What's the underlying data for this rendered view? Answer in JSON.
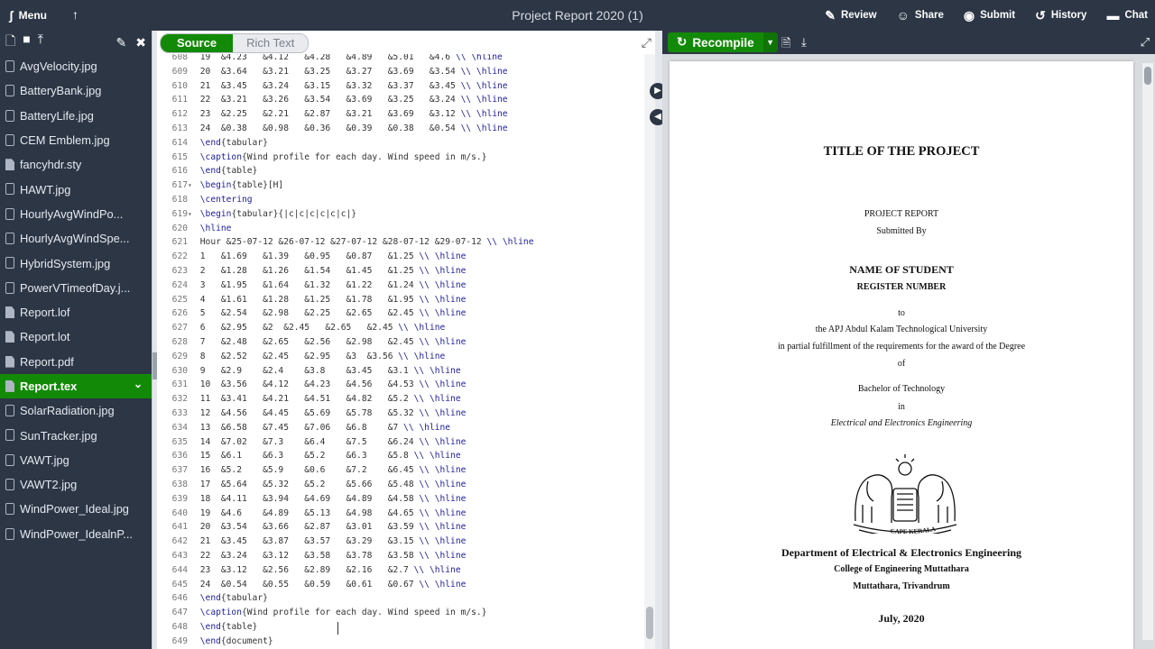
{
  "topbar": {
    "menu_label": "Menu",
    "project_title": "Project Report 2020 (1)",
    "actions": [
      {
        "label": "Review",
        "icon": "review-icon"
      },
      {
        "label": "Share",
        "icon": "share-icon"
      },
      {
        "label": "Submit",
        "icon": "submit-icon"
      },
      {
        "label": "History",
        "icon": "history-icon"
      },
      {
        "label": "Chat",
        "icon": "chat-icon"
      }
    ]
  },
  "sidebar": {
    "files": [
      {
        "name": "AvgVelocity.jpg",
        "kind": "image"
      },
      {
        "name": "BatteryBank.jpg",
        "kind": "image"
      },
      {
        "name": "BatteryLife.jpg",
        "kind": "image"
      },
      {
        "name": "CEM Emblem.jpg",
        "kind": "image"
      },
      {
        "name": "fancyhdr.sty",
        "kind": "doc"
      },
      {
        "name": "HAWT.jpg",
        "kind": "image"
      },
      {
        "name": "HourlyAvgWindPo...",
        "kind": "image"
      },
      {
        "name": "HourlyAvgWindSpe...",
        "kind": "image"
      },
      {
        "name": "HybridSystem.jpg",
        "kind": "image"
      },
      {
        "name": "PowerVTimeofDay.j...",
        "kind": "image"
      },
      {
        "name": "Report.lof",
        "kind": "doc"
      },
      {
        "name": "Report.lot",
        "kind": "doc"
      },
      {
        "name": "Report.pdf",
        "kind": "doc"
      },
      {
        "name": "Report.tex",
        "kind": "doc",
        "selected": true
      },
      {
        "name": "SolarRadiation.jpg",
        "kind": "image"
      },
      {
        "name": "SunTracker.jpg",
        "kind": "image"
      },
      {
        "name": "VAWT.jpg",
        "kind": "image"
      },
      {
        "name": "VAWT2.jpg",
        "kind": "image"
      },
      {
        "name": "WindPower_Ideal.jpg",
        "kind": "image"
      },
      {
        "name": "WindPower_IdealnP...",
        "kind": "image"
      }
    ]
  },
  "editor": {
    "mode_source": "Source",
    "mode_rich": "Rich Text",
    "lines": [
      {
        "n": "608",
        "text": "19  &4.23   &4.12   &4.28   &4.89   &5.01   &4.6 \\\\ \\hline"
      },
      {
        "n": "609",
        "text": "20  &3.64   &3.21   &3.25   &3.27   &3.69   &3.54 \\\\ \\hline"
      },
      {
        "n": "610",
        "text": "21  &3.45   &3.24   &3.15   &3.32   &3.37   &3.45 \\\\ \\hline"
      },
      {
        "n": "611",
        "text": "22  &3.21   &3.26   &3.54   &3.69   &3.25   &3.24 \\\\ \\hline"
      },
      {
        "n": "612",
        "text": "23  &2.25   &2.21   &2.87   &3.21   &3.69   &3.12 \\\\ \\hline"
      },
      {
        "n": "613",
        "text": "24  &0.38   &0.98   &0.36   &0.39   &0.38   &0.54 \\\\ \\hline"
      },
      {
        "n": "614",
        "text": "\\end{tabular}"
      },
      {
        "n": "615",
        "text": "\\caption{Wind profile for each day. Wind speed in m/s.}"
      },
      {
        "n": "616",
        "text": "\\end{table}"
      },
      {
        "n": "617",
        "text": "\\begin{table}[H]",
        "fold": true
      },
      {
        "n": "618",
        "text": "\\centering"
      },
      {
        "n": "619",
        "text": "\\begin{tabular}{|c|c|c|c|c|c|}",
        "fold": true
      },
      {
        "n": "620",
        "text": "\\hline"
      },
      {
        "n": "621",
        "text": "Hour &25-07-12 &26-07-12 &27-07-12 &28-07-12 &29-07-12 \\\\ \\hline"
      },
      {
        "n": "622",
        "text": "1   &1.69   &1.39   &0.95   &0.87   &1.25 \\\\ \\hline"
      },
      {
        "n": "623",
        "text": "2   &1.28   &1.26   &1.54   &1.45   &1.25 \\\\ \\hline"
      },
      {
        "n": "624",
        "text": "3   &1.95   &1.64   &1.32   &1.22   &1.24 \\\\ \\hline"
      },
      {
        "n": "625",
        "text": "4   &1.61   &1.28   &1.25   &1.78   &1.95 \\\\ \\hline"
      },
      {
        "n": "626",
        "text": "5   &2.54   &2.98   &2.25   &2.65   &2.45 \\\\ \\hline"
      },
      {
        "n": "627",
        "text": "6   &2.95   &2  &2.45   &2.65   &2.45 \\\\ \\hline"
      },
      {
        "n": "628",
        "text": "7   &2.48   &2.65   &2.56   &2.98   &2.45 \\\\ \\hline"
      },
      {
        "n": "629",
        "text": "8   &2.52   &2.45   &2.95   &3  &3.56 \\\\ \\hline"
      },
      {
        "n": "630",
        "text": "9   &2.9    &2.4    &3.8    &3.45   &3.1 \\\\ \\hline"
      },
      {
        "n": "631",
        "text": "10  &3.56   &4.12   &4.23   &4.56   &4.53 \\\\ \\hline"
      },
      {
        "n": "632",
        "text": "11  &3.41   &4.21   &4.51   &4.82   &5.2 \\\\ \\hline"
      },
      {
        "n": "633",
        "text": "12  &4.56   &4.45   &5.69   &5.78   &5.32 \\\\ \\hline"
      },
      {
        "n": "634",
        "text": "13  &6.58   &7.45   &7.06   &6.8    &7 \\\\ \\hline"
      },
      {
        "n": "635",
        "text": "14  &7.02   &7.3    &6.4    &7.5    &6.24 \\\\ \\hline"
      },
      {
        "n": "636",
        "text": "15  &6.1    &6.3    &5.2    &6.3    &5.8 \\\\ \\hline"
      },
      {
        "n": "637",
        "text": "16  &5.2    &5.9    &0.6    &7.2    &6.45 \\\\ \\hline"
      },
      {
        "n": "638",
        "text": "17  &5.64   &5.32   &5.2    &5.66   &5.48 \\\\ \\hline"
      },
      {
        "n": "639",
        "text": "18  &4.11   &3.94   &4.69   &4.89   &4.58 \\\\ \\hline"
      },
      {
        "n": "640",
        "text": "19  &4.6    &4.89   &5.13   &4.98   &4.65 \\\\ \\hline"
      },
      {
        "n": "641",
        "text": "20  &3.54   &3.66   &2.87   &3.01   &3.59 \\\\ \\hline"
      },
      {
        "n": "642",
        "text": "21  &3.45   &3.87   &3.57   &3.29   &3.15 \\\\ \\hline"
      },
      {
        "n": "643",
        "text": "22  &3.24   &3.12   &3.58   &3.78   &3.58 \\\\ \\hline"
      },
      {
        "n": "644",
        "text": "23  &3.12   &2.56   &2.89   &2.16   &2.7 \\\\ \\hline"
      },
      {
        "n": "645",
        "text": "24  &0.54   &0.55   &0.59   &0.61   &0.67 \\\\ \\hline"
      },
      {
        "n": "646",
        "text": "\\end{tabular}"
      },
      {
        "n": "647",
        "text": "\\caption{Wind profile for each day. Wind speed in m/s.}"
      },
      {
        "n": "648",
        "text": "\\end{table}"
      },
      {
        "n": "649",
        "text": "\\end{document}"
      }
    ]
  },
  "pdf": {
    "recompile_label": "Recompile",
    "title": "TITLE OF THE PROJECT",
    "project_report": "PROJECT REPORT",
    "submitted_by": "Submitted By",
    "student_name": "NAME OF STUDENT",
    "register_number": "REGISTER NUMBER",
    "to": "to",
    "university": "the APJ Abdul Kalam Technological University",
    "fulfillment": "in partial fulfillment of the requirements for the award of the Degree",
    "of": "of",
    "degree": "Bachelor of Technology",
    "in": "in",
    "branch": "Electrical and Electronics Engineering",
    "department": "Department of Electrical & Electronics Engineering",
    "college": "College of Engineering Muttathara",
    "location": "Muttathara, Trivandrum",
    "date": "July, 2020",
    "emblem_motto": "CAPE KERALA",
    "emblem_sub": "CE MUTTATHARA"
  }
}
